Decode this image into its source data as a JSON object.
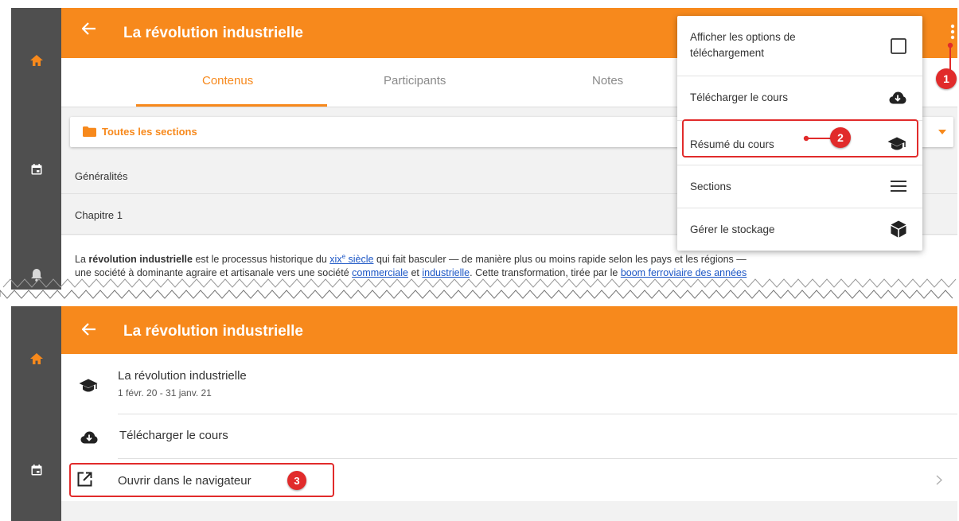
{
  "colors": {
    "accent": "#f7891c",
    "sidebar": "#4f4f4f",
    "callout": "#e12b2b",
    "link": "#1a55c5"
  },
  "top_screen": {
    "header": {
      "back_icon": "arrow-left-icon",
      "title": "La révolution industrielle",
      "more_icon": "more-vertical-icon"
    },
    "tabs": [
      {
        "label": "Contenus",
        "active": true
      },
      {
        "label": "Participants",
        "active": false
      },
      {
        "label": "Notes",
        "active": false
      }
    ],
    "section_selector": {
      "icon": "folder-icon",
      "label": "Toutes les sections"
    },
    "sections": [
      {
        "label": "Généralités"
      },
      {
        "label": "Chapitre 1"
      }
    ],
    "paragraph": {
      "t1": "La ",
      "b1": "révolution industrielle",
      "t2": " est le processus historique du ",
      "link1": "xix",
      "link1_sup": "e",
      "link1b": " siècle",
      "t3": " qui fait basculer — de manière plus ou moins rapide selon les pays et les régions —",
      "t4": "une société à dominante agraire et artisanale vers une société ",
      "link2": "commerciale",
      "t5": " et ",
      "link3": "industrielle",
      "t6": ". Cette transformation, tirée par le ",
      "link4": "boom ferroviaire des années"
    },
    "menu": [
      {
        "label": "Afficher les options de téléchargement",
        "icon": "checkbox-icon"
      },
      {
        "label": "Télécharger le cours",
        "icon": "cloud-download-icon"
      },
      {
        "label": "Résumé du cours",
        "icon": "graduation-cap-icon"
      },
      {
        "label": "Sections",
        "icon": "menu-lines-icon"
      },
      {
        "label": "Gérer le stockage",
        "icon": "cube-icon"
      }
    ]
  },
  "bottom_screen": {
    "header": {
      "back_icon": "arrow-left-icon",
      "title": "La révolution industrielle"
    },
    "course": {
      "icon": "graduation-cap-icon",
      "title": "La révolution industrielle",
      "dates": "1 févr. 20 - 31 janv. 21"
    },
    "download": {
      "icon": "cloud-download-icon",
      "label": "Télécharger le cours"
    },
    "open_browser": {
      "icon": "open-external-icon",
      "label": "Ouvrir dans le navigateur",
      "chevron": "chevron-right-icon"
    }
  },
  "sidebar": {
    "items": [
      {
        "icon": "home-icon"
      },
      {
        "icon": "calendar-icon"
      },
      {
        "icon": "bell-icon"
      }
    ]
  },
  "callouts": [
    "1",
    "2",
    "3"
  ]
}
